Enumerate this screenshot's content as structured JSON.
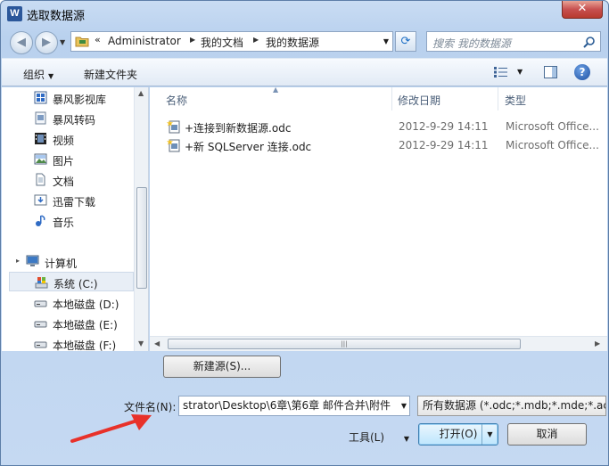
{
  "window": {
    "title": "选取数据源",
    "app_icon": "word-icon",
    "close_label": "✕"
  },
  "nav": {
    "back_label": "◀",
    "forward_label": "▶",
    "address": {
      "overflow": "«",
      "crumbs": [
        "Administrator",
        "我的文档",
        "我的数据源"
      ]
    },
    "search_placeholder": "搜索 我的数据源"
  },
  "toolbar": {
    "organize_label": "组织",
    "new_folder_label": "新建文件夹",
    "help_label": "?"
  },
  "sidebar": {
    "items": [
      {
        "label": "暴风影视库",
        "icon": "library-icon"
      },
      {
        "label": "暴风转码",
        "icon": "library-icon"
      },
      {
        "label": "视频",
        "icon": "video-icon"
      },
      {
        "label": "图片",
        "icon": "picture-icon"
      },
      {
        "label": "文档",
        "icon": "document-icon"
      },
      {
        "label": "迅雷下载",
        "icon": "download-icon"
      },
      {
        "label": "音乐",
        "icon": "music-icon"
      },
      {
        "label": "计算机",
        "icon": "computer-icon"
      },
      {
        "label": "系统 (C:)",
        "icon": "system-drive-icon",
        "selected": true
      },
      {
        "label": "本地磁盘 (D:)",
        "icon": "drive-icon"
      },
      {
        "label": "本地磁盘 (E:)",
        "icon": "drive-icon"
      },
      {
        "label": "本地磁盘 (F:)",
        "icon": "drive-icon"
      }
    ]
  },
  "filelist": {
    "columns": {
      "name": "名称",
      "modified": "修改日期",
      "type": "类型"
    },
    "files": [
      {
        "name": "+连接到新数据源.odc",
        "modified": "2012-9-29 14:11",
        "type": "Microsoft Office..."
      },
      {
        "name": "+新 SQLServer 连接.odc",
        "modified": "2012-9-29 14:11",
        "type": "Microsoft Office..."
      }
    ]
  },
  "bottom": {
    "new_source_label": "新建源(S)...",
    "filename_label": "文件名(N):",
    "filename_value": "strator\\Desktop\\6章\\第6章 邮件合并\\附件",
    "filetype_value": "所有数据源 (*.odc;*.mdb;*.mde;*.accd",
    "tools_label": "工具(L)",
    "open_label": "打开(O)",
    "cancel_label": "取消"
  },
  "colors": {
    "accent": "#1d6fc5",
    "annotation_arrow": "#e8312a"
  }
}
